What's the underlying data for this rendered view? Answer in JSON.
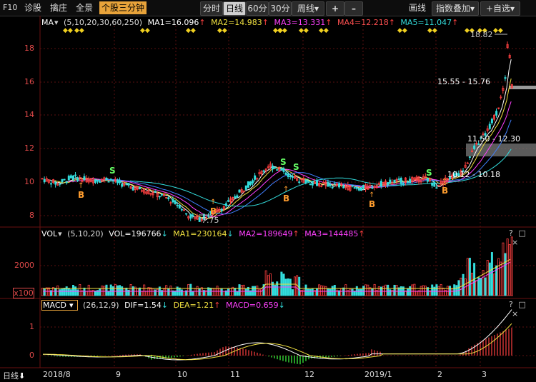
{
  "toolbar": {
    "f10": "F10",
    "diagnose": "诊股",
    "select": "擒庄",
    "full": "全景",
    "three_min": "个股三分钟",
    "periods": [
      "分时",
      "日线",
      "60分",
      "30分",
      "周线▾"
    ],
    "active_period": "日线",
    "plus": "+",
    "minus": "–",
    "draw": "画线",
    "indicator": "指数叠加",
    "indicator_arrow": "▾",
    "add_watch": "+自选",
    "add_watch_arrow": "▾"
  },
  "ma_legend": {
    "name": "MA",
    "params": "(5,10,20,30,60,250)",
    "ma1": "MA1=16.096",
    "ma2": "MA2=14.983",
    "ma3": "MA3=13.331",
    "ma4": "MA4=12.218",
    "ma5": "MA5=11.047"
  },
  "vol_legend": {
    "name": "VOL",
    "params": "(5,10,20)",
    "vol": "VOL=196766",
    "ma1": "MA1=230164",
    "ma2": "MA2=189649",
    "ma3": "MA3=144485"
  },
  "macd_legend": {
    "name": "MACD",
    "params": "(26,12,9)",
    "dif": "DIF=1.54",
    "dea": "DEA=1.21",
    "macd": "MACD=0.659"
  },
  "panel_controls": {
    "help": "?",
    "zoom": "□",
    "close": "×"
  },
  "price_axis": [
    "18",
    "16",
    "14",
    "12",
    "10",
    "8"
  ],
  "volume_axis": [
    "2000",
    "x100"
  ],
  "macd_axis": [
    "1",
    "0"
  ],
  "annotations": {
    "high": "18.82",
    "low": "7.75",
    "range1": "15.55 - 15.76",
    "range2": "11.50 - 12.30",
    "range3": "10.12 - 10.18"
  },
  "signals": {
    "buy": "B",
    "sell": "S"
  },
  "date_axis": {
    "label": "日线",
    "ticks": [
      "2018/8",
      "9",
      "10",
      "11",
      "12",
      "2019/1",
      "2",
      "3"
    ]
  },
  "colors": {
    "up": "#ff4040",
    "down": "#33dddd",
    "ma1": "#ffffff",
    "ma2": "#f0e040",
    "ma3": "#ff40ff",
    "ma4": "#40ff40",
    "ma5": "#4080ff",
    "buy": "#ff9d2e",
    "sell": "#66ff66"
  }
}
